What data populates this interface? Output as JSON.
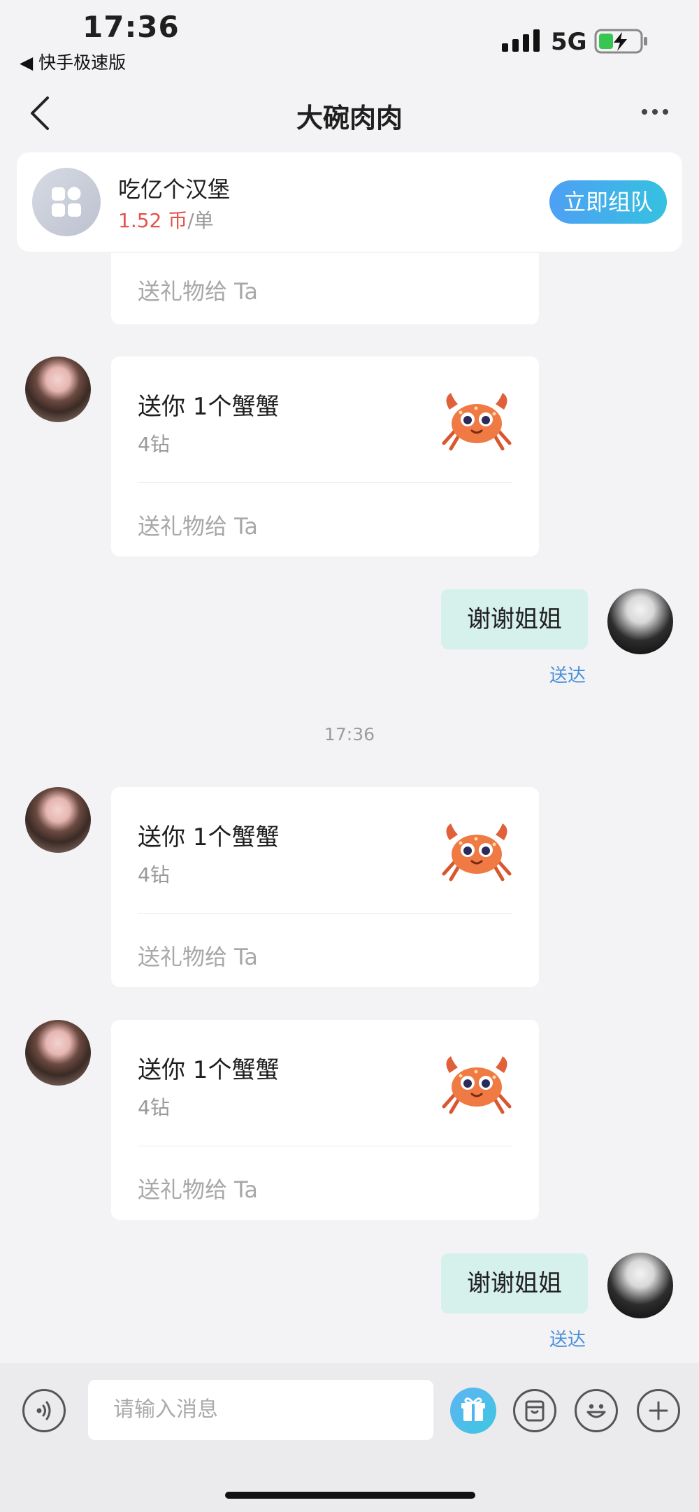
{
  "status_bar": {
    "time": "17:36",
    "back_app": "◀ 快手极速版",
    "network": "5G"
  },
  "nav": {
    "title": "大碗肉肉"
  },
  "promo": {
    "title": "吃亿个汉堡",
    "price": "1.52 币",
    "unit": "/单",
    "button": "立即组队"
  },
  "messages": [
    {
      "type": "gift_partial",
      "send_gift_label": "送礼物给 Ta"
    },
    {
      "type": "gift",
      "title": "送你 1个蟹蟹",
      "price": "4钻",
      "send_gift_label": "送礼物给 Ta"
    },
    {
      "type": "text_self",
      "text": "谢谢姐姐",
      "status": "送达"
    },
    {
      "type": "timestamp",
      "text": "17:36"
    },
    {
      "type": "gift",
      "title": "送你 1个蟹蟹",
      "price": "4钻",
      "send_gift_label": "送礼物给 Ta"
    },
    {
      "type": "gift",
      "title": "送你 1个蟹蟹",
      "price": "4钻",
      "send_gift_label": "送礼物给 Ta"
    },
    {
      "type": "text_self",
      "text": "谢谢姐姐",
      "status": "送达"
    }
  ],
  "input": {
    "placeholder": "请输入消息"
  },
  "icons": [
    "back-icon",
    "more-icon",
    "voice-icon",
    "gift-icon",
    "package-icon",
    "emoji-icon",
    "plus-icon"
  ],
  "colors": {
    "accent_blue": "#4ea0f4",
    "price_red": "#e3534a",
    "bubble_self": "#d6f0ec",
    "delivered": "#4a90d9"
  }
}
